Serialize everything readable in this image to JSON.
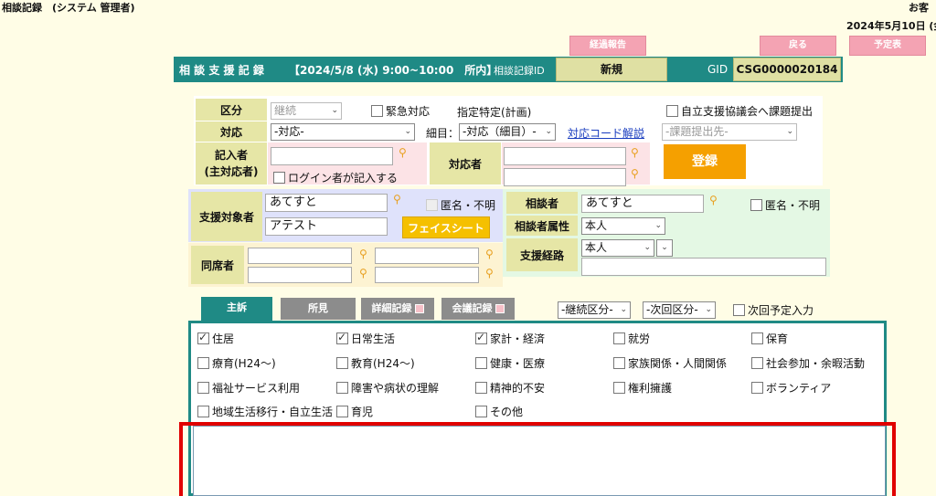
{
  "page": {
    "title": "相談記録　(システム 管理者)",
    "customer_corner": "お客",
    "date": "2024年5月10日 (金"
  },
  "top_buttons": {
    "progress_report": "経過報告",
    "back": "戻る",
    "schedule": "予定表"
  },
  "header": {
    "title": "相 談 支 援 記 録",
    "datetime": "【2024/5/8 (水) 9:00~10:00　所内】",
    "record_id_label": "相談記録ID",
    "record_id_value": "新規",
    "gid_label": "GID",
    "gid_value": "CSG0000020184"
  },
  "form": {
    "kubun_label": "区分",
    "kubun_value": "継続",
    "urgent_label": "緊急対応",
    "designated_label": "指定特定(計画)",
    "council_label": "自立支援協議会へ課題提出",
    "taiou_label": "対応",
    "taiou_value": "-対応-",
    "detail_label": "細目：",
    "detail_value": "-対応（細目）-",
    "code_link": "対応コード解説",
    "issue_dest_value": "-課題提出先-",
    "writer_label_1": "記入者",
    "writer_label_2": "(主対応者)",
    "login_writer_label": "ログイン者が記入する",
    "responder_label": "対応者",
    "register_button": "登録",
    "target_label": "支援対象者",
    "target_name": "あてすと",
    "target_kana": "アテスト",
    "anonymous_label": "匿名・不明",
    "face_sheet_button": "フェイスシート",
    "consultant_label": "相談者",
    "consultant_name": "あてすと",
    "consultant_anonymous_label": "匿名・不明",
    "consultant_attr_label": "相談者属性",
    "consultant_attr_value": "本人",
    "route_label": "支援経路",
    "route_value": "本人",
    "attendee_label": "同席者"
  },
  "tabs": {
    "main": "主訴",
    "findings": "所見",
    "detail": "詳細記録",
    "meeting": "会議記録",
    "continue_select": "-継続区分-",
    "next_select": "-次回区分-",
    "next_plan_label": "次回予定入力"
  },
  "categories": [
    {
      "label": "住居",
      "checked": true
    },
    {
      "label": "日常生活",
      "checked": true
    },
    {
      "label": "家計・経済",
      "checked": true
    },
    {
      "label": "就労",
      "checked": false
    },
    {
      "label": "保育",
      "checked": false
    },
    {
      "label": "療育(H24～)",
      "checked": false
    },
    {
      "label": "教育(H24～)",
      "checked": false
    },
    {
      "label": "健康・医療",
      "checked": false
    },
    {
      "label": "家族関係・人間関係",
      "checked": false
    },
    {
      "label": "社会参加・余暇活動",
      "checked": false
    },
    {
      "label": "福祉サービス利用",
      "checked": false
    },
    {
      "label": "障害や病状の理解",
      "checked": false
    },
    {
      "label": "精神的不安",
      "checked": false
    },
    {
      "label": "権利擁護",
      "checked": false
    },
    {
      "label": "ボランティア",
      "checked": false
    },
    {
      "label": "地域生活移行・自立生活",
      "checked": false
    },
    {
      "label": "育児",
      "checked": false
    },
    {
      "label": "その他",
      "checked": false
    }
  ],
  "colors": {
    "teal": "#1f8a85",
    "pink_button": "#f4a3b3",
    "register_orange": "#f5a000",
    "face_sheet_yellow": "#f5c000",
    "highlight_red": "#e00000"
  }
}
